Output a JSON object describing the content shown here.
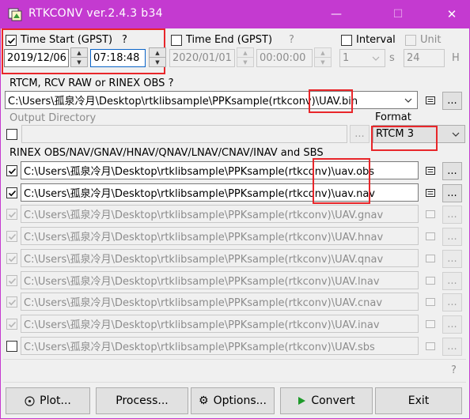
{
  "window": {
    "title": "RTKCONV ver.2.4.3 b34",
    "minimize_label": "—",
    "maximize_label": "☐",
    "close_label": "✕"
  },
  "time_start": {
    "label": "Time Start (GPST)",
    "help": "?",
    "checked": true,
    "date": "2019/12/06",
    "time": "07:18:48"
  },
  "time_end": {
    "label": "Time End (GPST)",
    "help": "?",
    "checked": false,
    "date": "2020/01/01",
    "time": "00:00:00"
  },
  "interval": {
    "label": "Interval",
    "checked": false,
    "value": "1",
    "unit": "s"
  },
  "unit": {
    "label": "Unit",
    "checked": false,
    "value": "24",
    "unit": "H"
  },
  "input_file": {
    "label": "RTCM, RCV RAW or RINEX OBS",
    "help": "?",
    "path": "C:\\Users\\孤泉冷月\\Desktop\\rtklibsample\\PPKsample(rtkconv)\\UAV.bin",
    "browse_label": "..."
  },
  "output_dir": {
    "label": "Output Directory",
    "checked": false,
    "value": "",
    "browse_label": "..."
  },
  "format": {
    "label": "Format",
    "value": "RTCM 3"
  },
  "rinex": {
    "label": "RINEX OBS/NAV/GNAV/HNAV/QNAV/LNAV/CNAV/INAV and SBS",
    "files": [
      {
        "path": "C:\\Users\\孤泉冷月\\Desktop\\rtklibsample\\PPKsample(rtkconv)\\uav.obs",
        "checked": true,
        "enabled": true,
        "browse_label": "..."
      },
      {
        "path": "C:\\Users\\孤泉冷月\\Desktop\\rtklibsample\\PPKsample(rtkconv)\\uav.nav",
        "checked": true,
        "enabled": true,
        "browse_label": "..."
      },
      {
        "path": "C:\\Users\\孤泉冷月\\Desktop\\rtklibsample\\PPKsample(rtkconv)\\UAV.gnav",
        "checked": true,
        "enabled": false,
        "browse_label": "..."
      },
      {
        "path": "C:\\Users\\孤泉冷月\\Desktop\\rtklibsample\\PPKsample(rtkconv)\\UAV.hnav",
        "checked": true,
        "enabled": false,
        "browse_label": "..."
      },
      {
        "path": "C:\\Users\\孤泉冷月\\Desktop\\rtklibsample\\PPKsample(rtkconv)\\UAV.qnav",
        "checked": true,
        "enabled": false,
        "browse_label": "..."
      },
      {
        "path": "C:\\Users\\孤泉冷月\\Desktop\\rtklibsample\\PPKsample(rtkconv)\\UAV.lnav",
        "checked": true,
        "enabled": false,
        "browse_label": "..."
      },
      {
        "path": "C:\\Users\\孤泉冷月\\Desktop\\rtklibsample\\PPKsample(rtkconv)\\UAV.cnav",
        "checked": true,
        "enabled": false,
        "browse_label": "..."
      },
      {
        "path": "C:\\Users\\孤泉冷月\\Desktop\\rtklibsample\\PPKsample(rtkconv)\\UAV.inav",
        "checked": true,
        "enabled": false,
        "browse_label": "..."
      },
      {
        "path": "C:\\Users\\孤泉冷月\\Desktop\\rtklibsample\\PPKsample(rtkconv)\\UAV.sbs",
        "checked": false,
        "enabled": false,
        "browse_label": "..."
      }
    ]
  },
  "status": {
    "message": "",
    "help": "?"
  },
  "buttons": {
    "plot": "Plot...",
    "process": "Process...",
    "options": "Options...",
    "convert": "Convert",
    "exit": "Exit"
  },
  "colors": {
    "titlebar": "#c43ad0",
    "highlight": "#e8262a"
  }
}
